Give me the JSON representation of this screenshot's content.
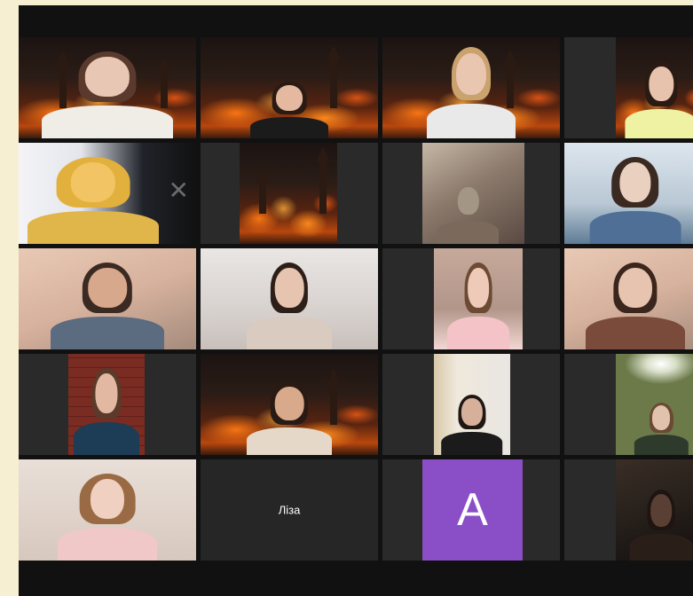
{
  "window": {
    "background_color": "#111111"
  },
  "colors": {
    "page_background": "#f7efd2",
    "tile_background": "#1f1f1f",
    "avatar_background": "#8a4ec7"
  },
  "participants": [
    {
      "row": 1,
      "col": 1,
      "type": "video",
      "background": "burning-city"
    },
    {
      "row": 1,
      "col": 2,
      "type": "video",
      "background": "burning-city"
    },
    {
      "row": 1,
      "col": 3,
      "type": "video",
      "background": "burning-city"
    },
    {
      "row": 1,
      "col": 4,
      "type": "video",
      "background": "burning-city"
    },
    {
      "row": 2,
      "col": 1,
      "type": "video",
      "background": "window-room"
    },
    {
      "row": 2,
      "col": 2,
      "type": "video",
      "background": "burning-city"
    },
    {
      "row": 2,
      "col": 3,
      "type": "video",
      "background": "cat-on-desk"
    },
    {
      "row": 2,
      "col": 4,
      "type": "video",
      "background": "headphones-room"
    },
    {
      "row": 3,
      "col": 1,
      "type": "video",
      "background": "warm-room"
    },
    {
      "row": 3,
      "col": 2,
      "type": "video",
      "background": "balloons-room"
    },
    {
      "row": 3,
      "col": 3,
      "type": "video",
      "background": "pink-room"
    },
    {
      "row": 3,
      "col": 4,
      "type": "video",
      "background": "warm-room"
    },
    {
      "row": 4,
      "col": 1,
      "type": "video",
      "background": "brick-wall"
    },
    {
      "row": 4,
      "col": 2,
      "type": "video",
      "background": "burning-city"
    },
    {
      "row": 4,
      "col": 3,
      "type": "video",
      "background": "door-room"
    },
    {
      "row": 4,
      "col": 4,
      "type": "video",
      "background": "ceiling-light"
    },
    {
      "row": 5,
      "col": 1,
      "type": "video",
      "background": "bedroom"
    },
    {
      "row": 5,
      "col": 2,
      "type": "name",
      "name": "Ліза"
    },
    {
      "row": 5,
      "col": 3,
      "type": "avatar",
      "initial": "A"
    },
    {
      "row": 5,
      "col": 4,
      "type": "video",
      "background": "dim-room"
    }
  ],
  "name_tile": {
    "label": "Ліза"
  },
  "avatar_tile": {
    "initial": "A"
  }
}
